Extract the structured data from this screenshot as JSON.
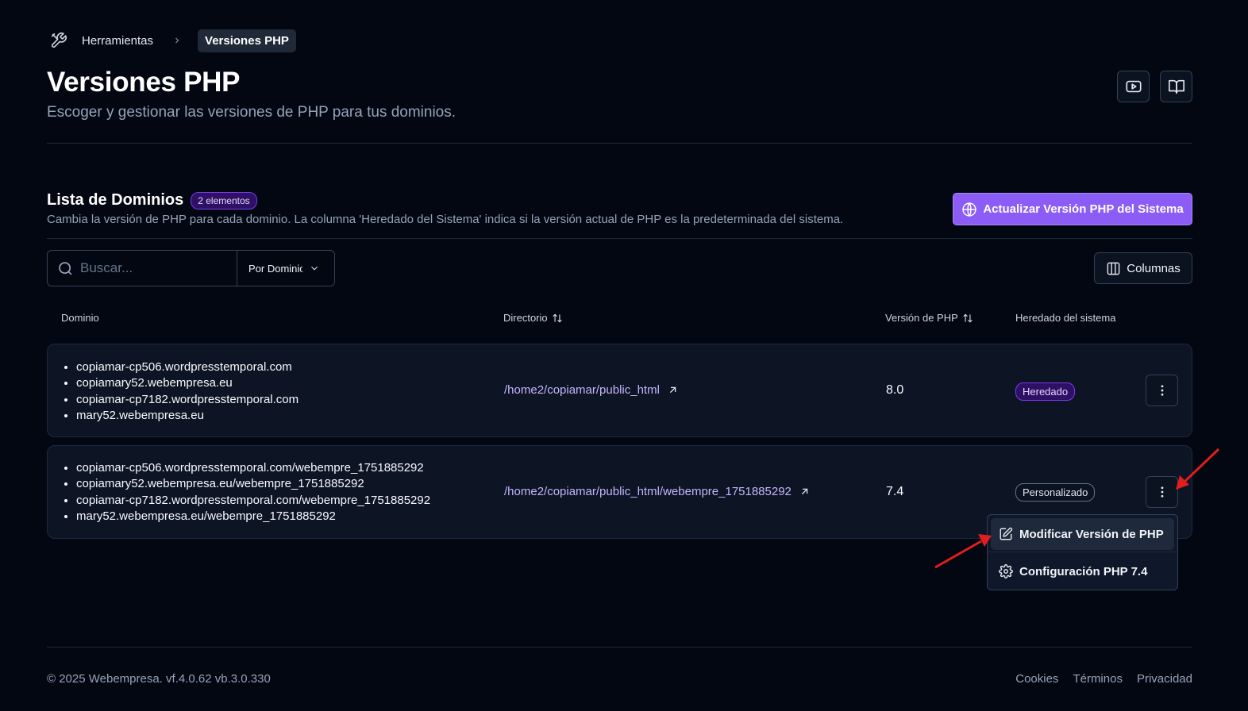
{
  "breadcrumb": {
    "icon": "tools-icon",
    "parent": "Herramientas",
    "current": "Versiones PHP"
  },
  "header": {
    "title": "Versiones PHP",
    "subtitle": "Escoger y gestionar las versiones de PHP para tus dominios.",
    "video_button_icon": "youtube-icon",
    "docs_button_icon": "book-open-icon"
  },
  "list": {
    "title": "Lista de Dominios",
    "count_badge": "2 elementos",
    "description": "Cambia la versión de PHP para cada dominio. La columna 'Heredado del Sistema' indica si la versión actual de PHP es la predeterminada del sistema.",
    "update_button": "Actualizar Versión PHP del Sistema"
  },
  "toolbar": {
    "search_placeholder": "Buscar...",
    "filter_value": "Por Dominio",
    "columns_button": "Columnas"
  },
  "table": {
    "headers": {
      "domain": "Dominio",
      "directory": "Directorio",
      "php_version": "Versión de PHP",
      "inherited": "Heredado del sistema"
    },
    "rows": [
      {
        "domains": [
          "copiamar-cp506.wordpresstemporal.com",
          "copiamary52.webempresa.eu",
          "copiamar-cp7182.wordpresstemporal.com",
          "mary52.webempresa.eu"
        ],
        "directory": "/home2/copiamar/public_html",
        "php_version": "8.0",
        "status": "Heredado"
      },
      {
        "domains": [
          "copiamar-cp506.wordpresstemporal.com/webempre_1751885292",
          "copiamary52.webempresa.eu/webempre_1751885292",
          "copiamar-cp7182.wordpresstemporal.com/webempre_1751885292",
          "mary52.webempresa.eu/webempre_1751885292"
        ],
        "directory": "/home2/copiamar/public_html/webempre_1751885292",
        "php_version": "7.4",
        "status": "Personalizado"
      }
    ]
  },
  "menu": {
    "items": [
      {
        "label": "Modificar Versión de PHP",
        "icon": "edit-icon"
      },
      {
        "label": "Configuración PHP 7.4",
        "icon": "gear-icon"
      }
    ]
  },
  "footer": {
    "copyright": "© 2025 Webempresa. vf.4.0.62 vb.3.0.330",
    "links": [
      "Cookies",
      "Términos",
      "Privacidad"
    ]
  },
  "colors": {
    "accent": "#8b5cf6",
    "link": "#c4b5fd",
    "annotation_arrow": "#e11d1d",
    "background": "#030712"
  }
}
